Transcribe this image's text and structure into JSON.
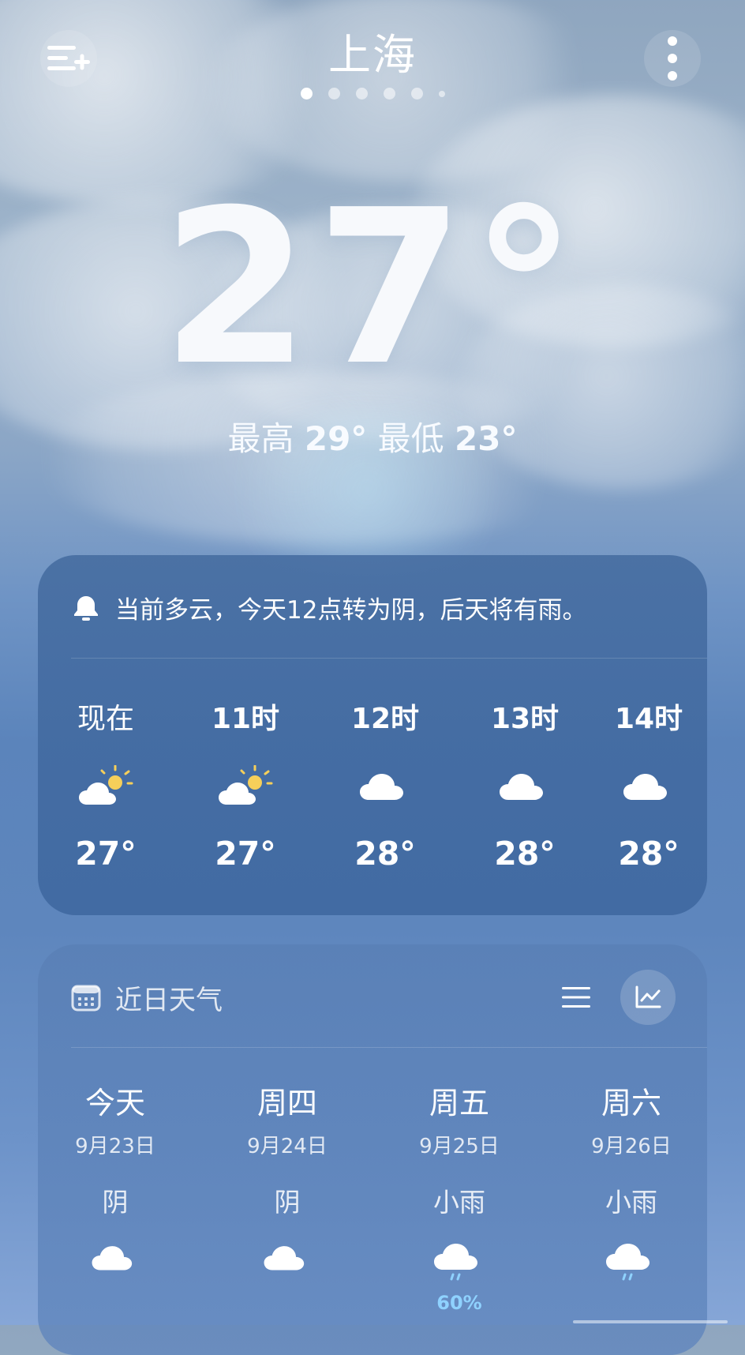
{
  "city": "上海",
  "page_indicator": {
    "count": 6,
    "active": 0
  },
  "current": {
    "temp": "27°",
    "high_label": "最高",
    "high": "29°",
    "low_label": "最低",
    "low": "23°"
  },
  "alert": {
    "text": "当前多云，今天12点转为阴，后天将有雨。",
    "icon": "bell-icon"
  },
  "hourly": [
    {
      "label": "现在",
      "icon": "partly-cloudy-icon",
      "temp": "27°"
    },
    {
      "label": "11时",
      "icon": "partly-cloudy-icon",
      "temp": "27°"
    },
    {
      "label": "12时",
      "icon": "cloud-icon",
      "temp": "28°"
    },
    {
      "label": "13时",
      "icon": "cloud-icon",
      "temp": "28°"
    },
    {
      "label": "14时",
      "icon": "cloud-icon",
      "temp": "28°"
    }
  ],
  "daily": {
    "title": "近日天气",
    "title_icon": "calendar-icon",
    "actions": [
      "list-view-icon",
      "chart-view-icon"
    ],
    "days": [
      {
        "name": "今天",
        "date": "9月23日",
        "cond": "阴",
        "icon": "cloud-icon",
        "precip": ""
      },
      {
        "name": "周四",
        "date": "9月24日",
        "cond": "阴",
        "icon": "cloud-icon",
        "precip": ""
      },
      {
        "name": "周五",
        "date": "9月25日",
        "cond": "小雨",
        "icon": "rain-icon",
        "precip": "60%"
      },
      {
        "name": "周六",
        "date": "9月26日",
        "cond": "小雨",
        "icon": "rain-icon",
        "precip": ""
      }
    ]
  },
  "colors": {
    "panel_hourly": "#4a6fa3",
    "panel_daily": "#6587bb",
    "precip": "#8fd2ff"
  }
}
